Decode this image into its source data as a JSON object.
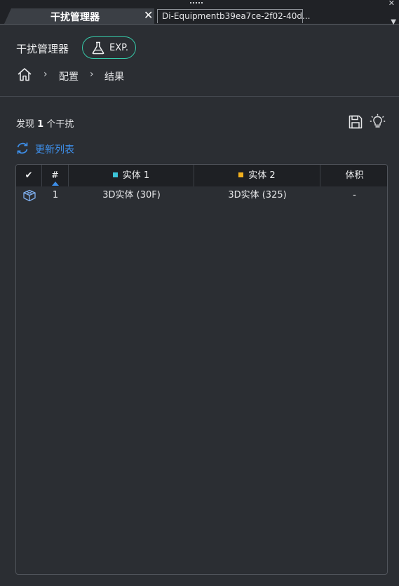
{
  "tabs": [
    {
      "label": "干扰管理器",
      "active": true
    },
    {
      "label": "Di-Equipmentb39ea7ce-2f02-40d...",
      "active": false
    }
  ],
  "header": {
    "title": "干扰管理器",
    "badge": "EXP."
  },
  "breadcrumb": {
    "items": [
      "配置",
      "结果"
    ]
  },
  "summary": {
    "prefix": "发现",
    "count": "1",
    "suffix": "个干扰"
  },
  "refresh": {
    "label": "更新列表"
  },
  "table": {
    "columns": [
      "✔",
      "#",
      "实体 1",
      "实体 2",
      "体积"
    ],
    "column_colors": {
      "entity1": "#3cc4d8",
      "entity2": "#f2b01e"
    },
    "rows": [
      {
        "index": "1",
        "entity1": "3D实体 (30F)",
        "entity2": "3D实体 (325)",
        "volume": "-"
      }
    ]
  },
  "colors": {
    "accent": "#3d8ee8",
    "badge_border": "#36c9a8"
  }
}
